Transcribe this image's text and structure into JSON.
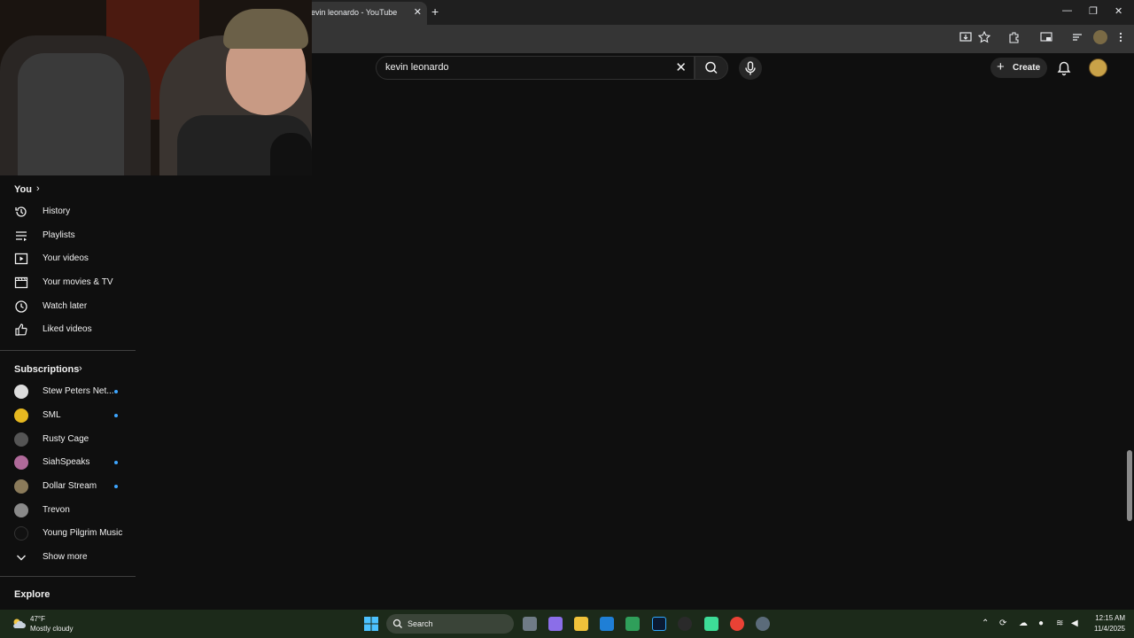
{
  "browser": {
    "tab_title": "evin leonardo - YouTube",
    "tab_close": "✕",
    "new_tab": "+",
    "minimize": "—",
    "restore": "❐",
    "close": "✕"
  },
  "header": {
    "search_value": "kevin leonardo",
    "clear_icon": "✕",
    "create_label": "Create",
    "create_plus": "+"
  },
  "sidebar": {
    "you_section": {
      "title": "You",
      "chevron": "›",
      "items": [
        {
          "label": "History",
          "icon": "history-icon"
        },
        {
          "label": "Playlists",
          "icon": "playlists-icon"
        },
        {
          "label": "Your videos",
          "icon": "your-videos-icon"
        },
        {
          "label": "Your movies & TV",
          "icon": "movies-icon"
        },
        {
          "label": "Watch later",
          "icon": "clock-icon"
        },
        {
          "label": "Liked videos",
          "icon": "thumbs-up-icon"
        }
      ]
    },
    "subscriptions": {
      "title": "Subscriptions",
      "chevron": "›",
      "items": [
        {
          "label": "Stew Peters Net...",
          "new": true,
          "color": "#dddddd"
        },
        {
          "label": "SML",
          "new": true,
          "color": "#e6b820"
        },
        {
          "label": "Rusty Cage",
          "new": false,
          "color": "#555555"
        },
        {
          "label": "SiahSpeaks",
          "new": true,
          "color": "#b06a9a"
        },
        {
          "label": "Dollar Stream",
          "new": true,
          "color": "#8a7a5a"
        },
        {
          "label": "Trevon",
          "new": false,
          "color": "#8a8a8a"
        },
        {
          "label": "Young Pilgrim Music",
          "new": false,
          "color": "#111111"
        }
      ],
      "show_more": "Show more"
    },
    "explore_title": "Explore"
  },
  "taskbar": {
    "weather_temp": "47°F",
    "weather_desc": "Mostly cloudy",
    "search_label": "Search",
    "time": "12:15 AM",
    "date": "11/4/2025"
  },
  "colors": {
    "background": "#0f0f0f",
    "accent_dot": "#3ea6ff"
  }
}
